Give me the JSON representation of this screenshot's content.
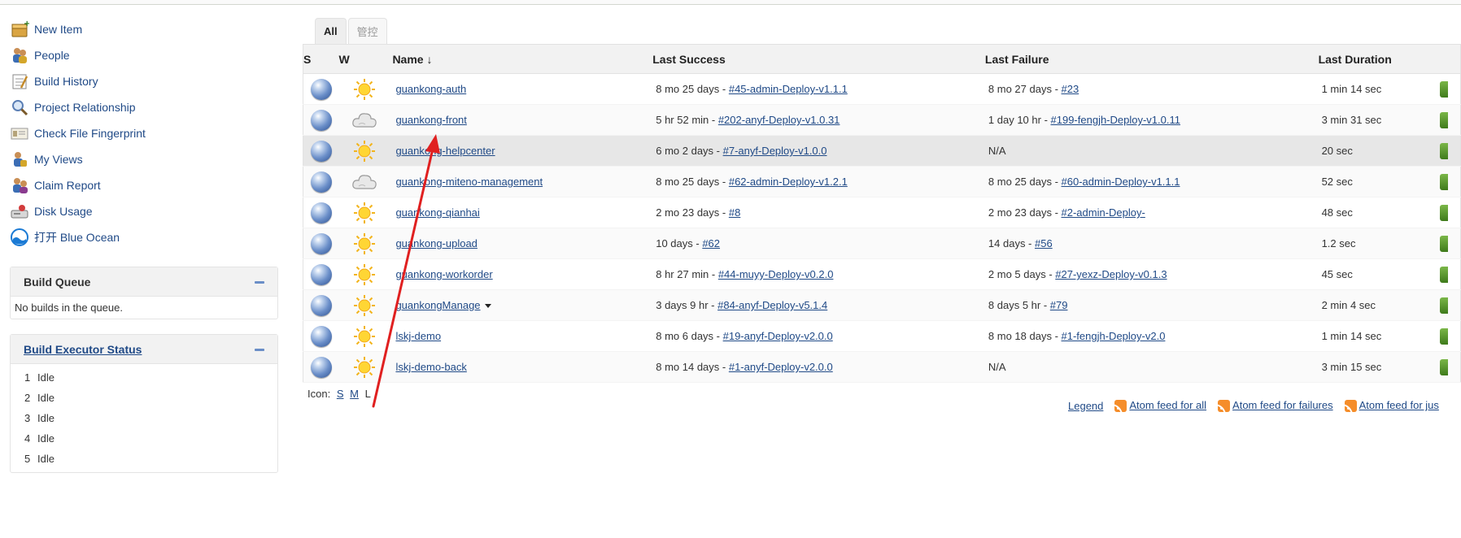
{
  "sidebar": {
    "tasks": [
      {
        "label": "New Item",
        "icon": "new-item-icon"
      },
      {
        "label": "People",
        "icon": "people-icon"
      },
      {
        "label": "Build History",
        "icon": "notepad-icon"
      },
      {
        "label": "Project Relationship",
        "icon": "magnifier-icon"
      },
      {
        "label": "Check File Fingerprint",
        "icon": "fingerprint-icon"
      },
      {
        "label": "My Views",
        "icon": "user-icon"
      },
      {
        "label": "Claim Report",
        "icon": "claim-icon"
      },
      {
        "label": "Disk Usage",
        "icon": "disk-icon"
      },
      {
        "label": "打开 Blue Ocean",
        "icon": "blue-ocean-icon"
      }
    ]
  },
  "build_queue": {
    "title": "Build Queue",
    "empty_text": "No builds in the queue."
  },
  "executors": {
    "title": "Build Executor Status",
    "rows": [
      {
        "num": "1",
        "status": "Idle"
      },
      {
        "num": "2",
        "status": "Idle"
      },
      {
        "num": "3",
        "status": "Idle"
      },
      {
        "num": "4",
        "status": "Idle"
      },
      {
        "num": "5",
        "status": "Idle"
      }
    ]
  },
  "tabs": [
    {
      "label": "All",
      "active": true
    },
    {
      "label": "管控",
      "active": false
    }
  ],
  "table": {
    "headers": {
      "s": "S",
      "w": "W",
      "name": "Name ↓",
      "last_success": "Last Success",
      "last_failure": "Last Failure",
      "last_duration": "Last Duration"
    },
    "rows": [
      {
        "name": "guankong-auth",
        "weather": "sunny",
        "succ_text": "8 mo 25 days - ",
        "succ_link": "#45-admin-Deploy-v1.1.1",
        "fail_text": "8 mo 27 days - ",
        "fail_link": "#23",
        "duration": "1 min 14 sec"
      },
      {
        "name": "guankong-front",
        "weather": "cloudy",
        "succ_text": "5 hr 52 min - ",
        "succ_link": "#202-anyf-Deploy-v1.0.31",
        "fail_text": "1 day 10 hr - ",
        "fail_link": "#199-fengjh-Deploy-v1.0.11",
        "duration": "3 min 31 sec"
      },
      {
        "name": "guankong-helpcenter",
        "weather": "sunny",
        "succ_text": "6 mo 2 days - ",
        "succ_link": "#7-anyf-Deploy-v1.0.0",
        "fail_text": "N/A",
        "fail_link": "",
        "duration": "20 sec"
      },
      {
        "name": "guankong-miteno-management",
        "weather": "cloudy",
        "succ_text": "8 mo 25 days - ",
        "succ_link": "#62-admin-Deploy-v1.2.1",
        "fail_text": "8 mo 25 days - ",
        "fail_link": "#60-admin-Deploy-v1.1.1",
        "duration": "52 sec"
      },
      {
        "name": "guankong-qianhai",
        "weather": "sunny",
        "succ_text": "2 mo 23 days - ",
        "succ_link": "#8",
        "fail_text": "2 mo 23 days - ",
        "fail_link": "#2-admin-Deploy-",
        "duration": "48 sec"
      },
      {
        "name": "guankong-upload",
        "weather": "sunny",
        "succ_text": "10 days - ",
        "succ_link": "#62",
        "fail_text": "14 days - ",
        "fail_link": "#56",
        "duration": "1.2 sec"
      },
      {
        "name": "guankong-workorder",
        "weather": "sunny",
        "succ_text": "8 hr 27 min - ",
        "succ_link": "#44-muyy-Deploy-v0.2.0",
        "fail_text": "2 mo 5 days - ",
        "fail_link": "#27-yexz-Deploy-v0.1.3",
        "duration": "45 sec"
      },
      {
        "name": "guankongManage",
        "weather": "sunny",
        "dropdown": true,
        "succ_text": "3 days 9 hr - ",
        "succ_link": "#84-anyf-Deploy-v5.1.4",
        "fail_text": "8 days 5 hr - ",
        "fail_link": "#79",
        "duration": "2 min 4 sec"
      },
      {
        "name": "lskj-demo",
        "weather": "sunny",
        "succ_text": "8 mo 6 days - ",
        "succ_link": "#19-anyf-Deploy-v2.0.0",
        "fail_text": "8 mo 18 days - ",
        "fail_link": "#1-fengjh-Deploy-v2.0",
        "duration": "1 min 14 sec"
      },
      {
        "name": "lskj-demo-back",
        "weather": "sunny",
        "succ_text": "8 mo 14 days - ",
        "succ_link": "#1-anyf-Deploy-v2.0.0",
        "fail_text": "N/A",
        "fail_link": "",
        "duration": "3 min 15 sec"
      }
    ]
  },
  "icon_size": {
    "label": "Icon:",
    "s": "S",
    "m": "M",
    "l": "L"
  },
  "footer": {
    "legend": "Legend",
    "feed_all": "Atom feed for all",
    "feed_failures": "Atom feed for failures",
    "feed_just": "Atom feed for jus"
  },
  "colors": {
    "link": "#204a87",
    "annotation_arrow": "#e02020"
  }
}
